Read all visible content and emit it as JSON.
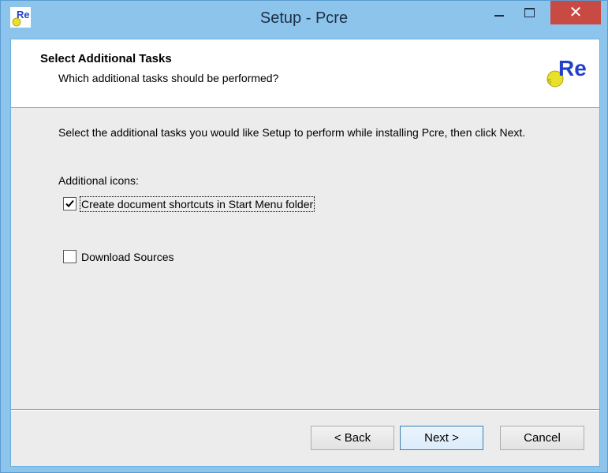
{
  "window": {
    "title": "Setup - Pcre",
    "controls": {
      "minimize": "minimize",
      "maximize": "maximize",
      "close": "close"
    },
    "icon": "pcre-re-icon"
  },
  "header": {
    "title": "Select Additional Tasks",
    "subtitle": "Which additional tasks should be performed?",
    "logo_text": "Re"
  },
  "content": {
    "instructions": "Select the additional tasks you would like Setup to perform while installing Pcre, then click Next.",
    "group_label": "Additional icons:",
    "tasks": [
      {
        "label": "Create document shortcuts in Start Menu folder",
        "checked": true,
        "focused": true
      },
      {
        "label": "Download Sources",
        "checked": false,
        "focused": false
      }
    ]
  },
  "buttons": {
    "back": "< Back",
    "next": "Next >",
    "cancel": "Cancel"
  },
  "colors": {
    "titlebar": "#8cc4ec",
    "close_button": "#c84a43",
    "dialog_background": "#ececec",
    "logo_blue": "#2340c8",
    "logo_yellow": "#e8e02a"
  }
}
